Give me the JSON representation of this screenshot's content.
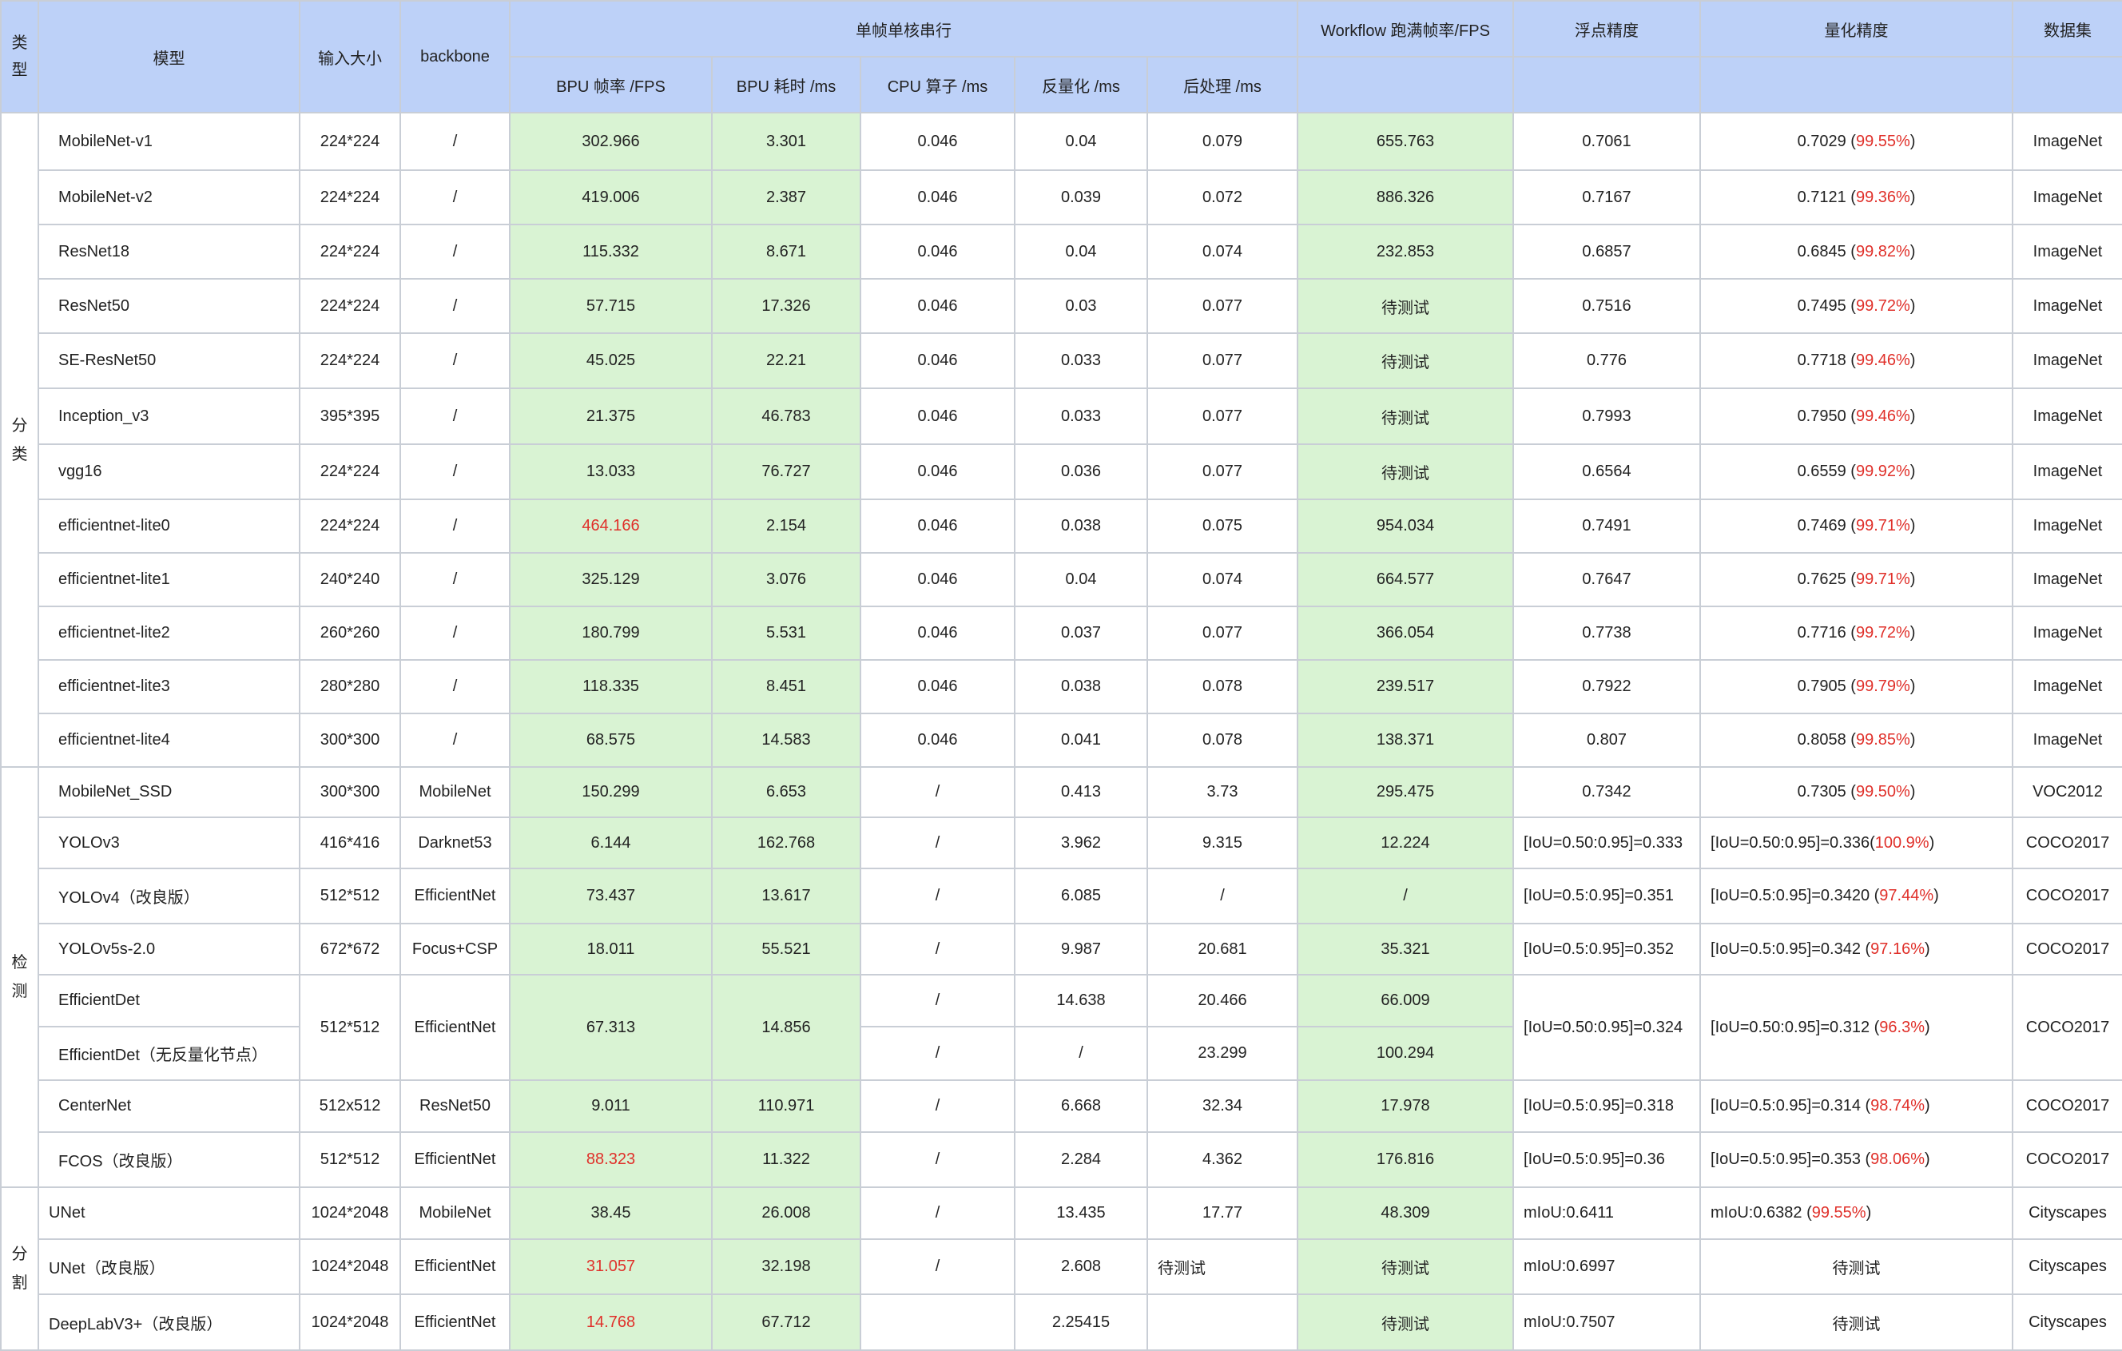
{
  "header": {
    "type": "类型",
    "model": "模型",
    "input_size": "输入大小",
    "backbone": "backbone",
    "single_core": "单帧单核串行",
    "bpu_fps": "BPU 帧率 /FPS",
    "bpu_ms": "BPU 耗时 /ms",
    "cpu_ms": "CPU 算子 /ms",
    "dequant_ms": "反量化 /ms",
    "post_ms": "后处理 /ms",
    "workflow": "Workflow 跑满帧率/FPS",
    "float_acc": "浮点精度",
    "quant_acc": "量化精度",
    "dataset": "数据集"
  },
  "categories": {
    "cls": "分类",
    "det": "检测",
    "seg": "分割"
  },
  "rows": [
    {
      "model": "MobileNet-v1",
      "size": "224*224",
      "backbone": "/",
      "bpu_fps": "302.966",
      "bpu_ms": "3.301",
      "cpu": "0.046",
      "deq": "0.04",
      "post": "0.079",
      "wf": "655.763",
      "float": "0.7061",
      "quant": "0.7029 (",
      "pct": "99.55%",
      "close": ")",
      "dataset": "ImageNet"
    },
    {
      "model": "MobileNet-v2",
      "size": "224*224",
      "backbone": "/",
      "bpu_fps": "419.006",
      "bpu_ms": "2.387",
      "cpu": "0.046",
      "deq": "0.039",
      "post": "0.072",
      "wf": "886.326",
      "float": "0.7167",
      "quant": "0.7121 (",
      "pct": "99.36%",
      "close": ")",
      "dataset": "ImageNet"
    },
    {
      "model": "ResNet18",
      "size": "224*224",
      "backbone": "/",
      "bpu_fps": "115.332",
      "bpu_ms": "8.671",
      "cpu": "0.046",
      "deq": "0.04",
      "post": "0.074",
      "wf": "232.853",
      "float": "0.6857",
      "quant": "0.6845 (",
      "pct": "99.82%",
      "close": ")",
      "dataset": "ImageNet"
    },
    {
      "model": "ResNet50",
      "size": "224*224",
      "backbone": "/",
      "bpu_fps": "57.715",
      "bpu_ms": "17.326",
      "cpu": "0.046",
      "deq": "0.03",
      "post": "0.077",
      "wf": "待测试",
      "float": "0.7516",
      "quant": "0.7495 (",
      "pct": "99.72%",
      "close": ")",
      "dataset": "ImageNet"
    },
    {
      "model": "SE-ResNet50",
      "size": "224*224",
      "backbone": "/",
      "bpu_fps": "45.025",
      "bpu_ms": "22.21",
      "cpu": "0.046",
      "deq": "0.033",
      "post": "0.077",
      "wf": "待测试",
      "float": "0.776",
      "quant": "0.7718 (",
      "pct": "99.46%",
      "close": ")",
      "dataset": "ImageNet"
    },
    {
      "model": "Inception_v3",
      "size": "395*395",
      "backbone": "/",
      "bpu_fps": "21.375",
      "bpu_ms": "46.783",
      "cpu": "0.046",
      "deq": "0.033",
      "post": "0.077",
      "wf": "待测试",
      "float": "0.7993",
      "quant": "0.7950 (",
      "pct": "99.46%",
      "close": ")",
      "dataset": "ImageNet"
    },
    {
      "model": "vgg16",
      "size": "224*224",
      "backbone": "/",
      "bpu_fps": "13.033",
      "bpu_ms": "76.727",
      "cpu": "0.046",
      "deq": "0.036",
      "post": "0.077",
      "wf": "待测试",
      "float": "0.6564",
      "quant": "0.6559 (",
      "pct": "99.92%",
      "close": ")",
      "dataset": "ImageNet"
    },
    {
      "model": "efficientnet-lite0",
      "size": "224*224",
      "backbone": "/",
      "bpu_fps": "464.166",
      "bpu_ms": "2.154",
      "cpu": "0.046",
      "deq": "0.038",
      "post": "0.075",
      "wf": "954.034",
      "float": "0.7491",
      "quant": "0.7469 (",
      "pct": "99.71%",
      "close": ")",
      "dataset": "ImageNet"
    },
    {
      "model": "efficientnet-lite1",
      "size": "240*240",
      "backbone": "/",
      "bpu_fps": "325.129",
      "bpu_ms": "3.076",
      "cpu": "0.046",
      "deq": "0.04",
      "post": "0.074",
      "wf": "664.577",
      "float": "0.7647",
      "quant": "0.7625 (",
      "pct": "99.71%",
      "close": ")",
      "dataset": "ImageNet"
    },
    {
      "model": "efficientnet-lite2",
      "size": "260*260",
      "backbone": "/",
      "bpu_fps": "180.799",
      "bpu_ms": "5.531",
      "cpu": "0.046",
      "deq": "0.037",
      "post": "0.077",
      "wf": "366.054",
      "float": "0.7738",
      "quant": "0.7716 (",
      "pct": "99.72%",
      "close": ")",
      "dataset": "ImageNet"
    },
    {
      "model": "efficientnet-lite3",
      "size": "280*280",
      "backbone": "/",
      "bpu_fps": "118.335",
      "bpu_ms": "8.451",
      "cpu": "0.046",
      "deq": "0.038",
      "post": "0.078",
      "wf": "239.517",
      "float": "0.7922",
      "quant": "0.7905 (",
      "pct": "99.79%",
      "close": ")",
      "dataset": "ImageNet"
    },
    {
      "model": "efficientnet-lite4",
      "size": "300*300",
      "backbone": "/",
      "bpu_fps": "68.575",
      "bpu_ms": "14.583",
      "cpu": "0.046",
      "deq": "0.041",
      "post": "0.078",
      "wf": "138.371",
      "float": "0.807",
      "quant": "0.8058 (",
      "pct": "99.85%",
      "close": ")",
      "dataset": "ImageNet"
    },
    {
      "model": "MobileNet_SSD",
      "size": "300*300",
      "backbone": "MobileNet",
      "bpu_fps": "150.299",
      "bpu_ms": "6.653",
      "cpu": "/",
      "deq": "0.413",
      "post": "3.73",
      "wf": "295.475",
      "float": "0.7342",
      "quant": "0.7305 (",
      "pct": "99.50%",
      "close": ")",
      "dataset": "VOC2012"
    },
    {
      "model": "YOLOv3",
      "size": "416*416",
      "backbone": "Darknet53",
      "bpu_fps": "6.144",
      "bpu_ms": "162.768",
      "cpu": "/",
      "deq": "3.962",
      "post": "9.315",
      "wf": "12.224",
      "float": "[IoU=0.50:0.95]=0.333",
      "quant": "[IoU=0.50:0.95]=0.336(",
      "pct": "100.9%",
      "close": ")",
      "dataset": "COCO2017"
    },
    {
      "model": "YOLOv4（改良版）",
      "size": "512*512",
      "backbone": "EfficientNet",
      "bpu_fps": "73.437",
      "bpu_ms": "13.617",
      "cpu": "/",
      "deq": "6.085",
      "post": "/",
      "wf": "/",
      "float": "[IoU=0.5:0.95]=0.351",
      "quant": "[IoU=0.5:0.95]=0.3420 (",
      "pct": "97.44%",
      "close": ")",
      "dataset": "COCO2017"
    },
    {
      "model": "YOLOv5s-2.0",
      "size": "672*672",
      "backbone": "Focus+CSP",
      "bpu_fps": "18.011",
      "bpu_ms": "55.521",
      "cpu": "/",
      "deq": "9.987",
      "post": "20.681",
      "wf": "35.321",
      "float": "[IoU=0.5:0.95]=0.352",
      "quant": "[IoU=0.5:0.95]=0.342 (",
      "pct": "97.16%",
      "close": ")",
      "dataset": "COCO2017"
    },
    {
      "model": "EfficientDet",
      "size": "512*512",
      "backbone": "EfficientNet",
      "bpu_fps": "67.313",
      "bpu_ms": "14.856",
      "cpu": "/",
      "deq": "14.638",
      "post": "20.466",
      "wf": "66.009",
      "float": "[IoU=0.50:0.95]=0.324",
      "quant": "[IoU=0.50:0.95]=0.312 (",
      "pct": "96.3%",
      "close": ")",
      "dataset": "COCO2017"
    },
    {
      "model": "EfficientDet（无反量化节点）",
      "cpu": "/",
      "deq": "/",
      "post": "23.299",
      "wf": "100.294"
    },
    {
      "model": "CenterNet",
      "size": "512x512",
      "backbone": "ResNet50",
      "bpu_fps": "9.011",
      "bpu_ms": "110.971",
      "cpu": "/",
      "deq": "6.668",
      "post": "32.34",
      "wf": "17.978",
      "float": "[IoU=0.5:0.95]=0.318",
      "quant": "[IoU=0.5:0.95]=0.314 (",
      "pct": "98.74%",
      "close": ")",
      "dataset": "COCO2017"
    },
    {
      "model": "FCOS（改良版）",
      "size": "512*512",
      "backbone": "EfficientNet",
      "bpu_fps": "88.323",
      "bpu_ms": "11.322",
      "cpu": "/",
      "deq": "2.284",
      "post": "4.362",
      "wf": "176.816",
      "float": "[IoU=0.5:0.95]=0.36",
      "quant": "[IoU=0.5:0.95]=0.353 (",
      "pct": "98.06%",
      "close": ")",
      "dataset": "COCO2017"
    },
    {
      "model": "UNet",
      "size": "1024*2048",
      "backbone": "MobileNet",
      "bpu_fps": "38.45",
      "bpu_ms": "26.008",
      "cpu": "/",
      "deq": "13.435",
      "post": "17.77",
      "wf": "48.309",
      "float": "mIoU:0.6411",
      "quant": "mIoU:0.6382 (",
      "pct": "99.55%",
      "close": ")",
      "dataset": "Cityscapes"
    },
    {
      "model": "UNet（改良版）",
      "size": "1024*2048",
      "backbone": "EfficientNet",
      "bpu_fps": "31.057",
      "bpu_ms": "32.198",
      "cpu": "/",
      "deq": "2.608",
      "post": "待测试",
      "wf": "待测试",
      "float": "mIoU:0.6997",
      "quant": "待测试",
      "dataset": "Cityscapes"
    },
    {
      "model": "DeepLabV3+（改良版）",
      "size": "1024*2048",
      "backbone": "EfficientNet",
      "bpu_fps": "14.768",
      "bpu_ms": "67.712",
      "cpu": "",
      "deq": "2.25415",
      "post": "",
      "wf": "待测试",
      "float": "mIoU:0.7507",
      "quant": "待测试",
      "dataset": "Cityscapes"
    }
  ]
}
